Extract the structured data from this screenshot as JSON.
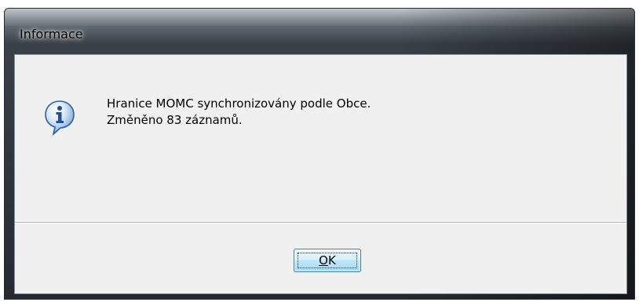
{
  "window": {
    "title": "Informace"
  },
  "message": {
    "line1": "Hranice MOMC synchronizovány podle Obce.",
    "line2": "Změněno 83 záznamů."
  },
  "icon": {
    "name": "information-icon",
    "color": "#1d5fb5"
  },
  "buttons": {
    "ok_mnemonic": "O",
    "ok_rest": "K"
  }
}
